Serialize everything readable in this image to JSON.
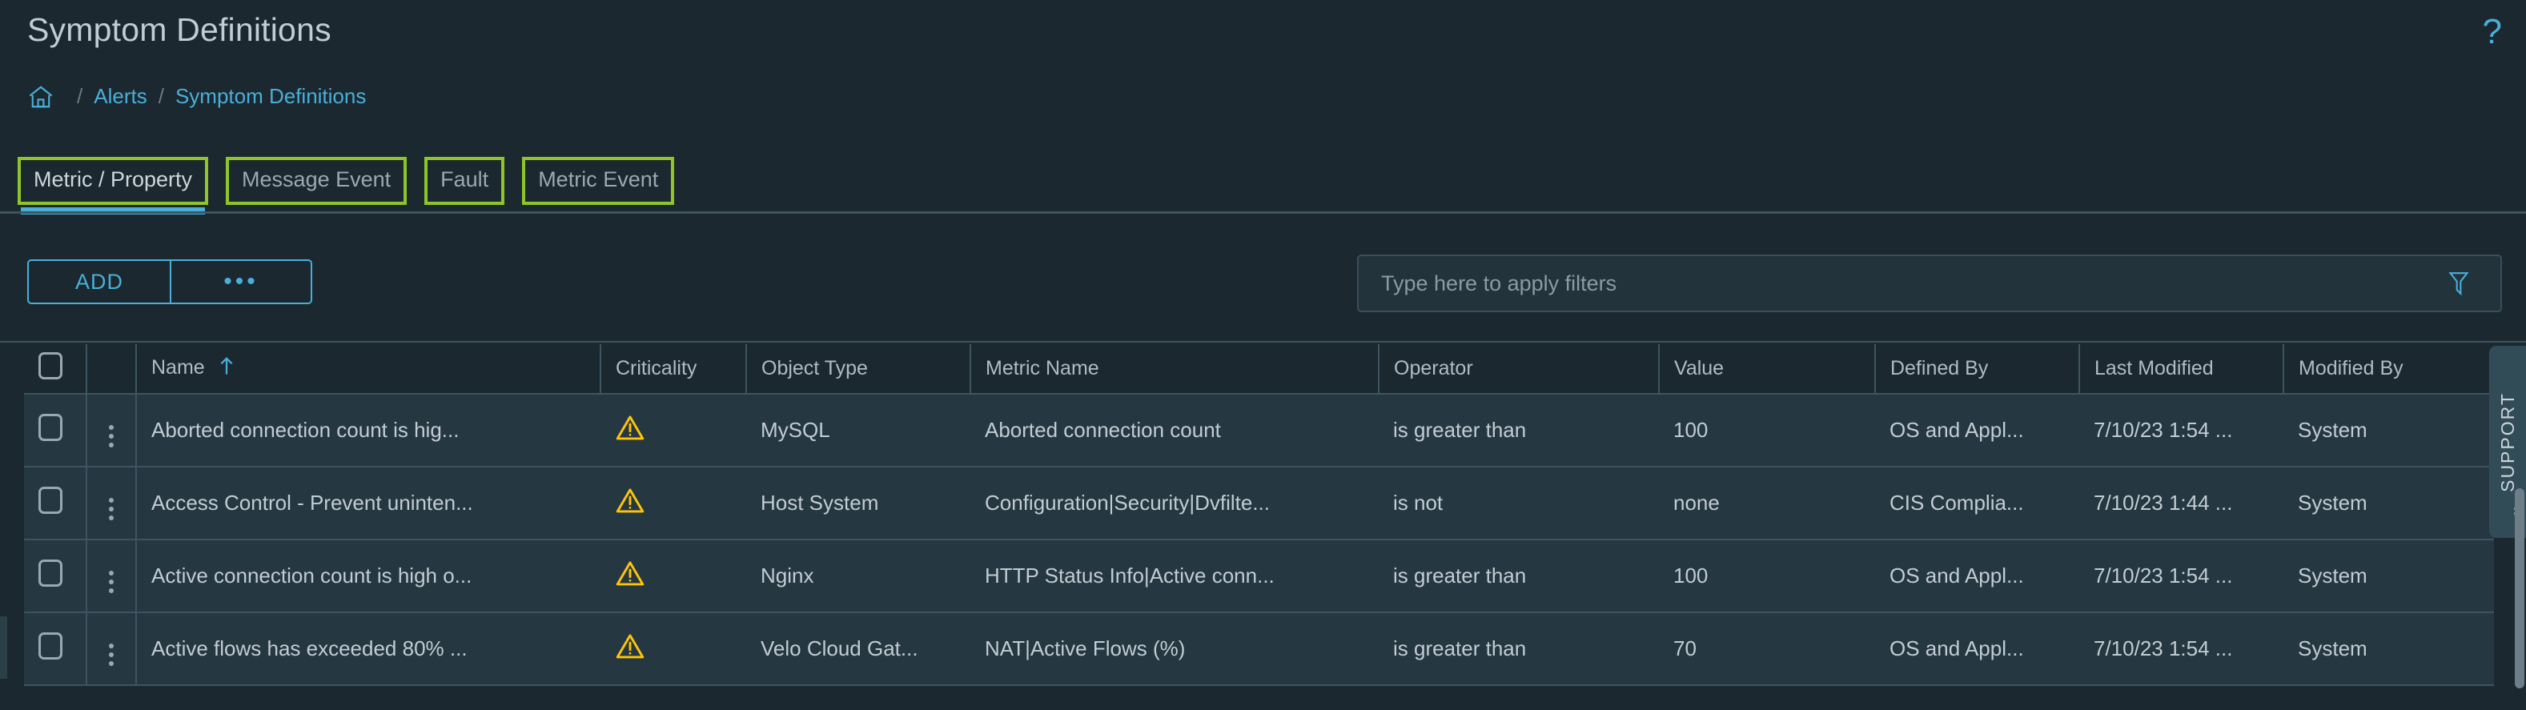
{
  "header": {
    "title": "Symptom Definitions",
    "help_icon": "question-mark-icon",
    "help_label": "?"
  },
  "breadcrumb": {
    "home_icon": "home-icon",
    "separator": "/",
    "items": [
      {
        "label": "Alerts"
      },
      {
        "label": "Symptom Definitions"
      }
    ]
  },
  "tabs": {
    "active_index": 0,
    "items": [
      {
        "label": "Metric / Property",
        "active": true
      },
      {
        "label": "Message Event",
        "active": false
      },
      {
        "label": "Fault",
        "active": false
      },
      {
        "label": "Metric Event",
        "active": false
      }
    ]
  },
  "toolbar": {
    "add_label": "ADD",
    "more_label": "•••",
    "filter_placeholder": "Type here to apply filters",
    "filter_value": "",
    "funnel_icon": "filter-funnel-icon"
  },
  "table": {
    "columns": [
      {
        "key": "select",
        "label": ""
      },
      {
        "key": "actions",
        "label": ""
      },
      {
        "key": "name",
        "label": "Name",
        "sorted": "asc",
        "sort_icon": "arrow-up-icon"
      },
      {
        "key": "criticality",
        "label": "Criticality"
      },
      {
        "key": "object_type",
        "label": "Object Type"
      },
      {
        "key": "metric_name",
        "label": "Metric Name"
      },
      {
        "key": "operator",
        "label": "Operator"
      },
      {
        "key": "value",
        "label": "Value"
      },
      {
        "key": "defined_by",
        "label": "Defined By"
      },
      {
        "key": "last_modified",
        "label": "Last Modified"
      },
      {
        "key": "modified_by",
        "label": "Modified By"
      }
    ],
    "rows": [
      {
        "name": "Aborted connection count is hig...",
        "criticality": "warning",
        "object_type": "MySQL",
        "metric_name": "Aborted connection count",
        "operator": "is greater than",
        "value": "100",
        "defined_by": "OS and Appl...",
        "last_modified": "7/10/23 1:54 ...",
        "modified_by": "System"
      },
      {
        "name": "Access Control - Prevent uninten...",
        "criticality": "warning",
        "object_type": "Host System",
        "metric_name": "Configuration|Security|Dvfilte...",
        "operator": "is not",
        "value": "none",
        "defined_by": "CIS Complia...",
        "last_modified": "7/10/23 1:44 ...",
        "modified_by": "System"
      },
      {
        "name": "Active connection count is high o...",
        "criticality": "warning",
        "object_type": "Nginx",
        "metric_name": "HTTP Status Info|Active conn...",
        "operator": "is greater than",
        "value": "100",
        "defined_by": "OS and Appl...",
        "last_modified": "7/10/23 1:54 ...",
        "modified_by": "System"
      },
      {
        "name": "Active flows has exceeded 80% ...",
        "criticality": "warning",
        "object_type": "Velo Cloud Gat...",
        "metric_name": "NAT|Active Flows (%)",
        "operator": "is greater than",
        "value": "70",
        "defined_by": "OS and Appl...",
        "last_modified": "7/10/23 1:54 ...",
        "modified_by": "System"
      }
    ]
  },
  "side_rail": {
    "label": "SUPPORT",
    "collapse_icon": "chevron-double-left-icon",
    "collapse_label": "«"
  },
  "colors": {
    "page_background": "#1b2830",
    "row_background": "#253741",
    "accent_blue": "#49afd9",
    "annotation_green": "#90c52a",
    "warning_yellow": "#fdc40a",
    "text_primary": "#c2ccd3",
    "border": "#3d5560"
  }
}
